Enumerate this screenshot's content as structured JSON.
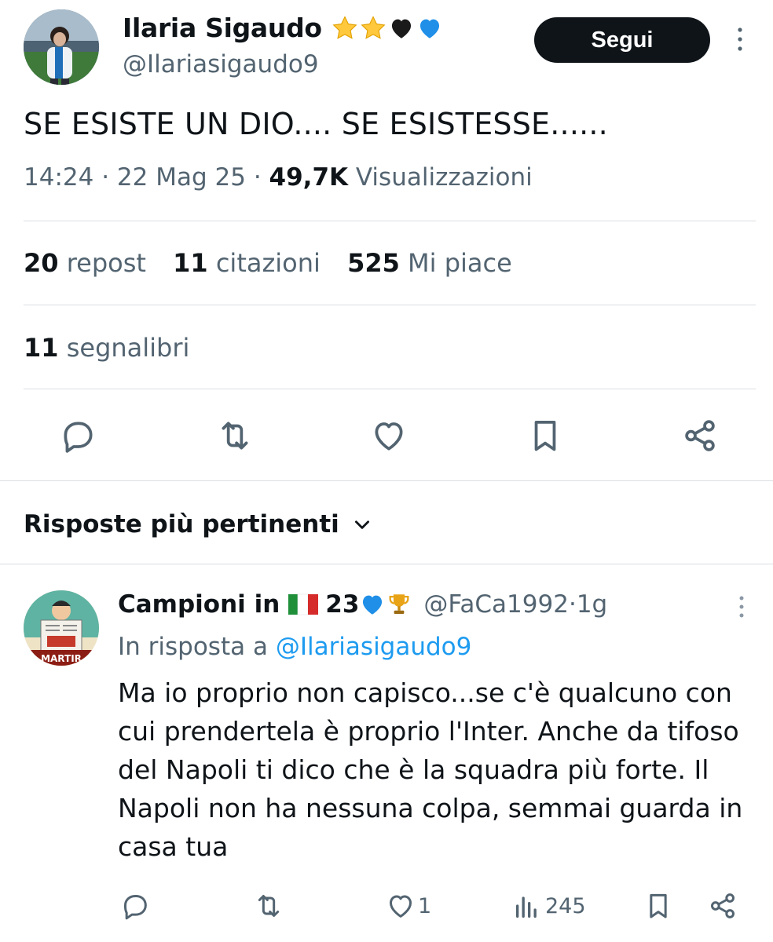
{
  "tweet": {
    "author_name": "Ilaria Sigaudo",
    "author_handle": "@Ilariasigaudo9",
    "author_emojis": [
      "star",
      "star",
      "black-heart",
      "blue-heart"
    ],
    "follow_label": "Segui",
    "text": "SE ESISTE UN DIO.... SE ESISTESSE......",
    "time": "14:24",
    "date": "22 Mag 25",
    "views_count": "49,7K",
    "views_label": "Visualizzazioni",
    "reposts_count": "20",
    "reposts_label": "repost",
    "quotes_count": "11",
    "quotes_label": "citazioni",
    "likes_count": "525",
    "likes_label": "Mi piace",
    "bookmarks_count": "11",
    "bookmarks_label": "segnalibri",
    "actions": [
      "reply-icon",
      "repost-icon",
      "like-icon",
      "bookmark-icon",
      "share-icon"
    ]
  },
  "replies_section": {
    "sort_label": "Risposte più pertinenti"
  },
  "reply": {
    "author_name": "Campioni in",
    "author_name_suffix": "23",
    "author_emojis": [
      "italy-flag",
      "blue-heart",
      "trophy"
    ],
    "author_handle": "@FaCa1992",
    "time": "1g",
    "reply_to_prefix": "In risposta a",
    "reply_to_handle": "@Ilariasigaudo9",
    "text": "Ma io proprio non capisco...se c'è qualcuno con cui prendertela è proprio l'Inter. Anche da tifoso del Napoli ti dico che è la squadra più forte. Il Napoli non ha nessuna colpa, semmai guarda in casa tua",
    "likes_count": "1",
    "views_count": "245",
    "avatar_text": "MARTIR"
  },
  "colors": {
    "text": "#0f1419",
    "secondary": "#536471",
    "link": "#1d9bf0",
    "divider": "#d9dee2",
    "button_bg": "#0f1419"
  }
}
